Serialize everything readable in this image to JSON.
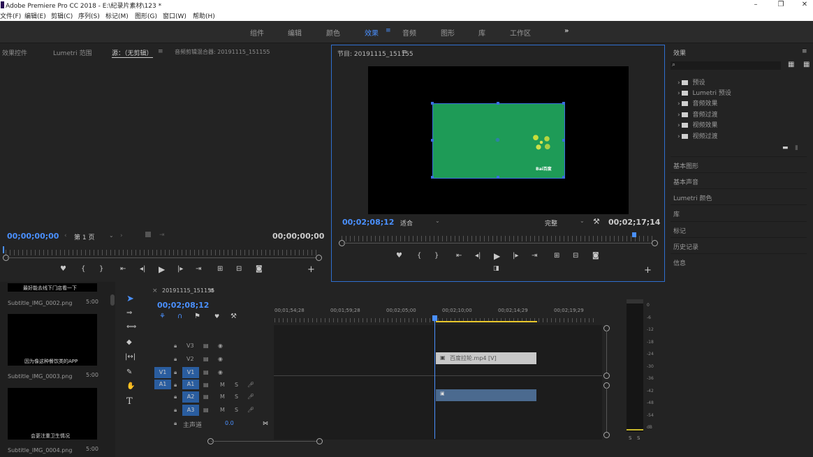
{
  "window": {
    "title": "Adobe Premiere Pro CC 2018 - E:\\纪录片素材\\123 *",
    "minimize": "–",
    "maximize": "❐",
    "close": "✕"
  },
  "menu": [
    "文件(F)",
    "编辑(E)",
    "剪辑(C)",
    "序列(S)",
    "标记(M)",
    "图形(G)",
    "窗口(W)",
    "帮助(H)"
  ],
  "workspaces": [
    "组件",
    "编辑",
    "颜色",
    "效果",
    "音频",
    "图形",
    "库",
    "工作区",
    "»"
  ],
  "active_workspace_index": 3,
  "source_panel": {
    "tabs": [
      "效果控件",
      "Lumetri 范围",
      "源：（无剪辑）",
      "音频剪辑混合器: 20191115_151155"
    ],
    "timecode_left": "00;00;00;00",
    "page": "第 1 页",
    "timecode_right": "00;00;00;00"
  },
  "program_panel": {
    "title": "节目: 20191115_151155",
    "timecode_left": "00;02;08;12",
    "fit": "适合",
    "quality": "完整",
    "timecode_right": "00;02;17;14",
    "logo_text": "Bai百度"
  },
  "project_panel": {
    "items": [
      {
        "caption": "最好能去线下门店看一下",
        "name": "Subtitle_IMG_0002.png",
        "duration": "5:00"
      },
      {
        "caption": "因为像这种餐饮类的APP",
        "name": "Subtitle_IMG_0003.png",
        "duration": "5:00"
      },
      {
        "caption": "会更注重卫生情况",
        "name": "Subtitle_IMG_0004.png",
        "duration": "5:00"
      }
    ]
  },
  "timeline": {
    "tab": "20191115_151155",
    "timecode": "00;02;08;12",
    "ruler": [
      "00;01;54;28",
      "00;01;59;28",
      "00;02;05;00",
      "00;02;10;00",
      "00;02;14;29",
      "00;02;19;29"
    ],
    "tracks": [
      {
        "target": "",
        "label": "V3"
      },
      {
        "target": "",
        "label": "V2"
      },
      {
        "target": "V1",
        "label": "V1"
      },
      {
        "target": "A1",
        "label": "A1"
      },
      {
        "target": "",
        "label": "A2"
      },
      {
        "target": "",
        "label": "A3"
      }
    ],
    "master": "主声道",
    "master_value": "0.0",
    "clip_video": "百度拉轮.mp4 [V]",
    "playhead_fraction": 0.49
  },
  "vu_meter": {
    "ticks": [
      "0",
      "-6",
      "-12",
      "-18",
      "-24",
      "-30",
      "-36",
      "-42",
      "-48",
      "-54",
      "dB"
    ],
    "solo": [
      "S",
      "S"
    ]
  },
  "effects_panel": {
    "title": "效果",
    "folders": [
      "预设",
      "Lumetri 预设",
      "音频效果",
      "音频过渡",
      "视频效果",
      "视频过渡"
    ],
    "sections": [
      "基本图形",
      "基本声音",
      "Lumetri 颜色",
      "库",
      "标记",
      "历史记录",
      "信息"
    ]
  }
}
